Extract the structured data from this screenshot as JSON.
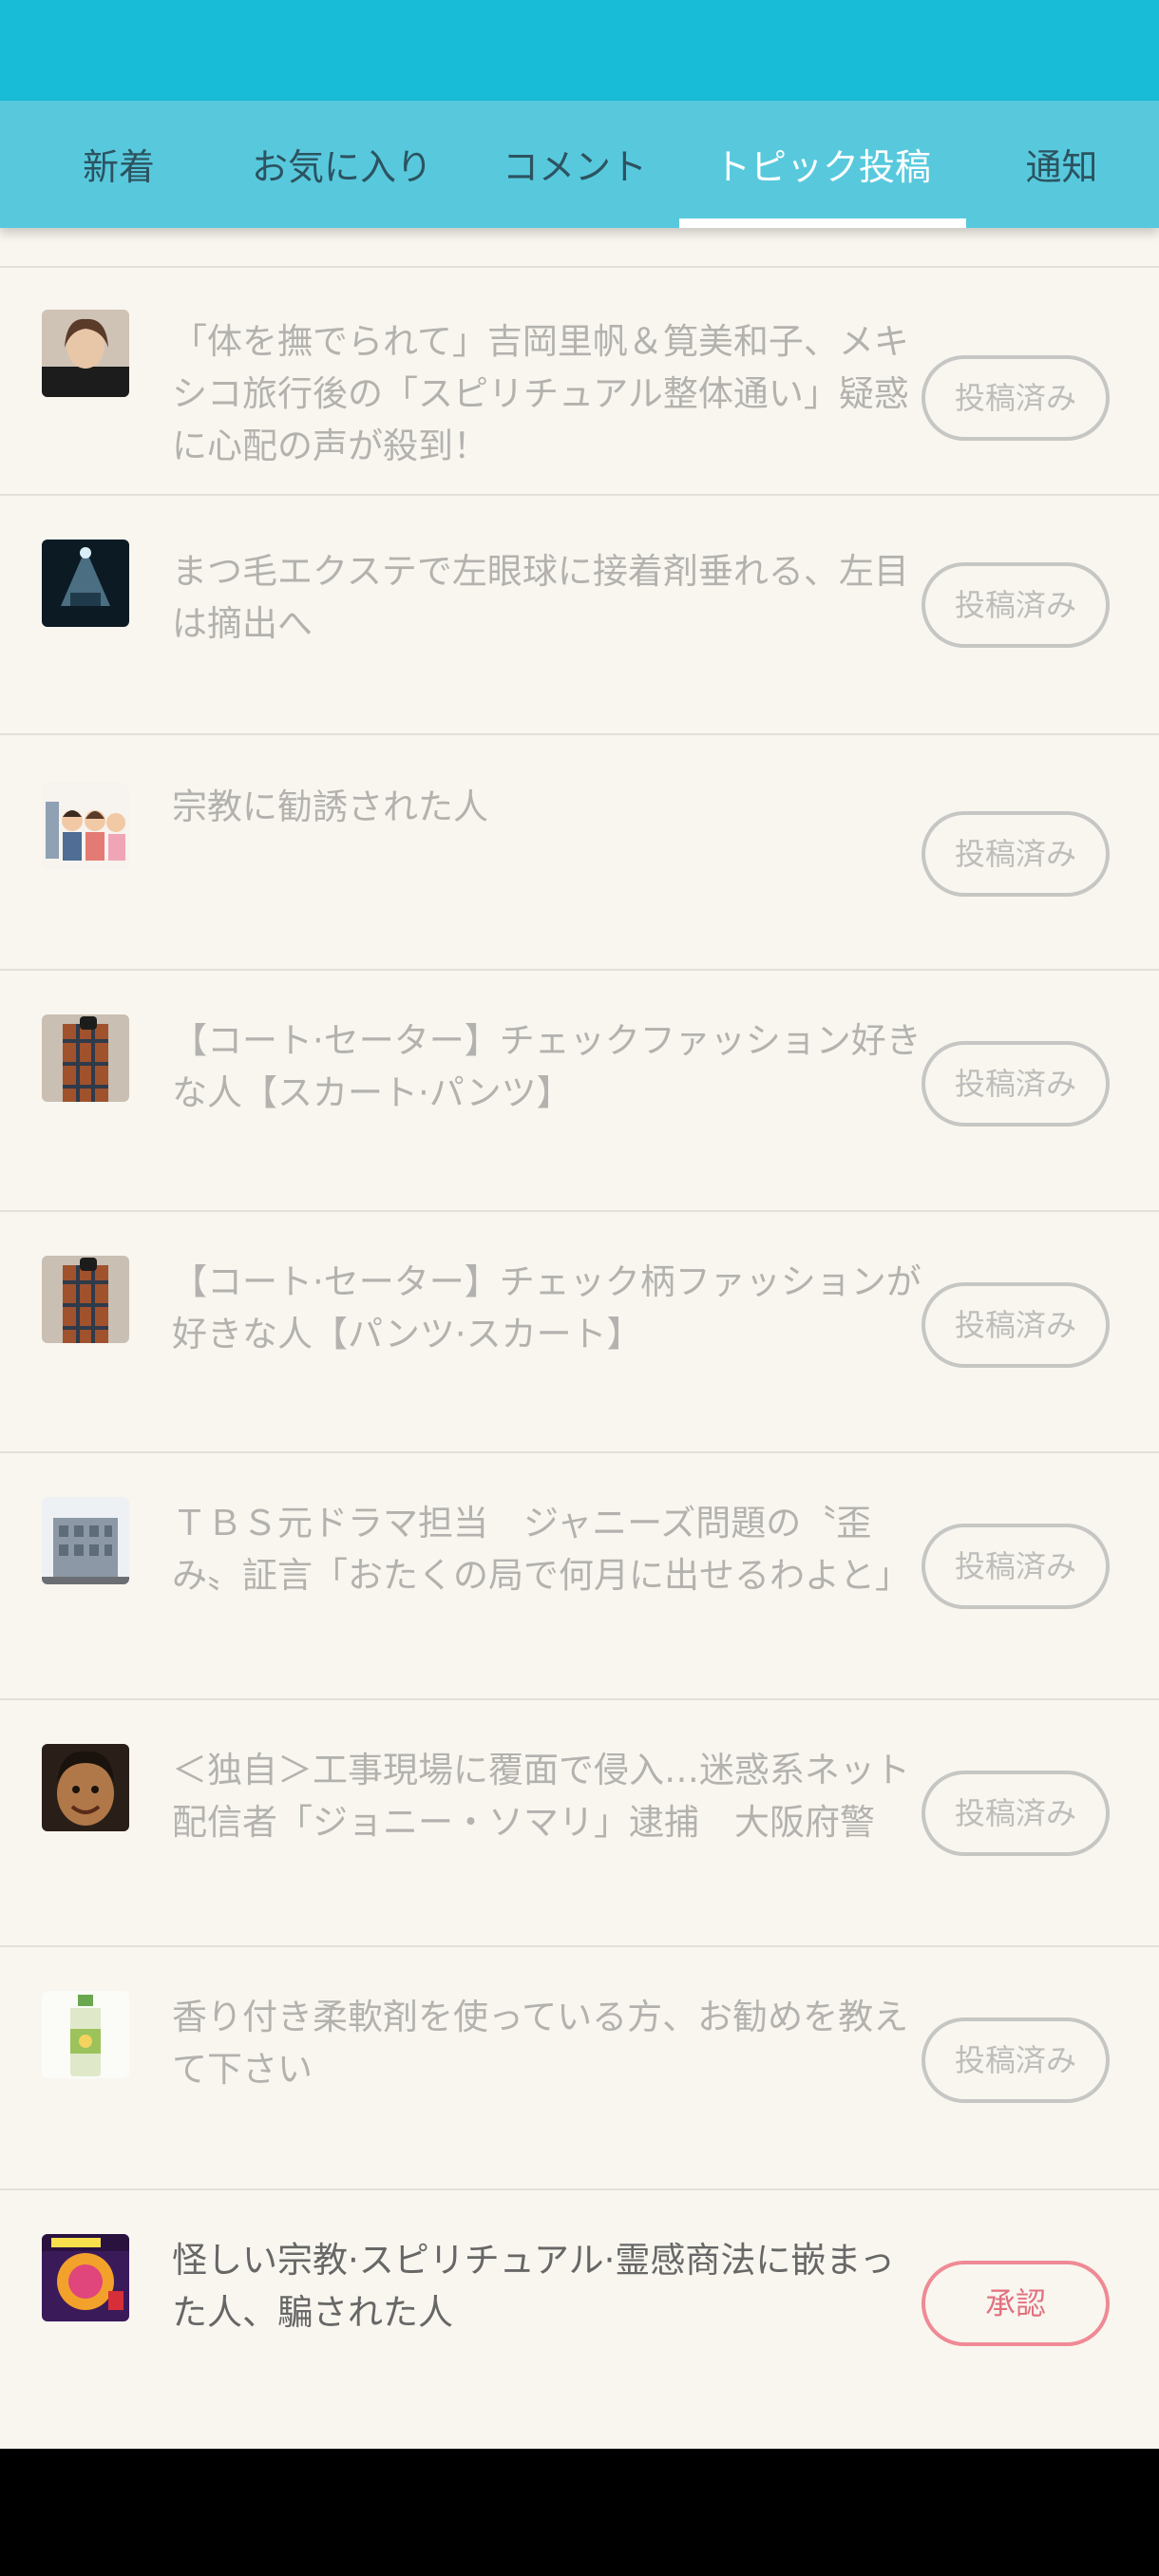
{
  "tabs": [
    {
      "label": "新着"
    },
    {
      "label": "お気に入り"
    },
    {
      "label": "コメント"
    },
    {
      "label": "トピック投稿",
      "active": true
    },
    {
      "label": "通知"
    }
  ],
  "items": [
    {
      "title": "「体を撫でられて」吉岡里帆＆筧美和子、メキシコ旅行後の「スピリチュアル整体通い」疑惑に心配の声が殺到！",
      "status": "投稿済み",
      "thumb_icon": "portrait-photo"
    },
    {
      "title": "まつ毛エクステで左眼球に接着剤垂れる、左目は摘出へ",
      "status": "投稿済み",
      "thumb_icon": "dark-room-photo"
    },
    {
      "title": "宗教に勧誘された人",
      "status": "投稿済み",
      "thumb_icon": "people-illustration"
    },
    {
      "title": "【コート·セーター】チェックファッション好きな人【スカート·パンツ】",
      "status": "投稿済み",
      "thumb_icon": "plaid-fashion-photo"
    },
    {
      "title": "【コート·セーター】チェック柄ファッションが好きな人【パンツ·スカート】",
      "status": "投稿済み",
      "thumb_icon": "plaid-fashion-photo"
    },
    {
      "title": "ＴＢＳ元ドラマ担当　ジャニーズ問題の〝歪み〟証言「おたくの局で何月に出せるわよと」",
      "status": "投稿済み",
      "thumb_icon": "building-photo"
    },
    {
      "title": "＜独自＞工事現場に覆面で侵入…迷惑系ネット配信者「ジョニー・ソマリ」逮捕　大阪府警",
      "status": "投稿済み",
      "thumb_icon": "face-photo"
    },
    {
      "title": "香り付き柔軟剤を使っている方、お勧めを教えて下さい",
      "status": "投稿済み",
      "thumb_icon": "bottle-photo"
    },
    {
      "title": "怪しい宗教·スピリチュアル·霊感商法に嵌まった人、騙された人",
      "status": "承認",
      "thumb_icon": "colorful-book-photo",
      "active": true
    }
  ],
  "colors": {
    "status_bar": "#19bcd6",
    "tab_bar": "#58c9dd",
    "background": "#f8f6ef",
    "posted_border": "#c6c6c4",
    "approve_border": "#ef8a95"
  }
}
